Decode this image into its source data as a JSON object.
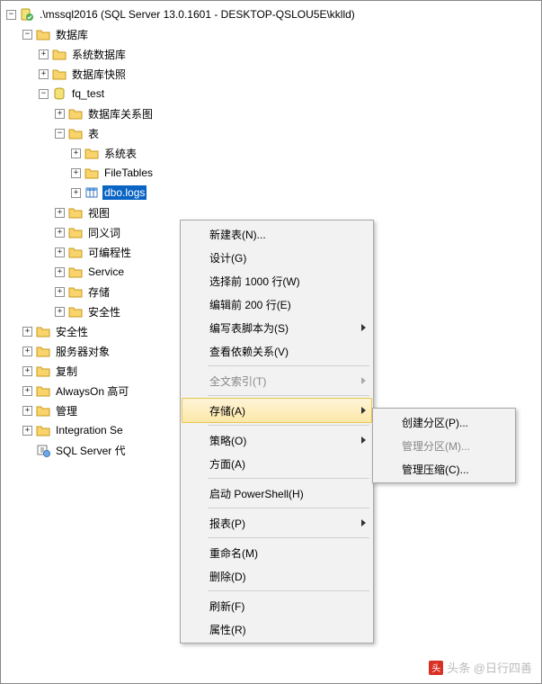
{
  "tree": {
    "root": ".\\mssql2016 (SQL Server 13.0.1601 - DESKTOP-QSLOU5E\\kklld)",
    "databases": "数据库",
    "system_dbs": "系统数据库",
    "db_snapshot": "数据库快照",
    "fq_test": "fq_test",
    "db_diagrams": "数据库关系图",
    "tables": "表",
    "system_tables": "系统表",
    "file_tables": "FileTables",
    "dbo_logs": "dbo.logs",
    "views": "视图",
    "synonyms": "同义词",
    "programmability": "可编程性",
    "service_broker": "Service",
    "storage": "存储",
    "security_db": "安全性",
    "security": "安全性",
    "server_objects": "服务器对象",
    "replication": "复制",
    "always_on": "AlwaysOn 高可",
    "management": "管理",
    "integration_services": "Integration Se",
    "sql_agent": "SQL Server 代"
  },
  "menu": {
    "new_table": "新建表(N)...",
    "design": "设计(G)",
    "select_top": "选择前 1000 行(W)",
    "edit_top": "编辑前 200 行(E)",
    "script_as": "编写表脚本为(S)",
    "view_deps": "查看依赖关系(V)",
    "fulltext": "全文索引(T)",
    "storage": "存储(A)",
    "policies": "策略(O)",
    "facets": "方面(A)",
    "powershell": "启动 PowerShell(H)",
    "reports": "报表(P)",
    "rename": "重命名(M)",
    "delete": "删除(D)",
    "refresh": "刷新(F)",
    "properties": "属性(R)"
  },
  "submenu": {
    "create_partition": "创建分区(P)...",
    "manage_partition": "管理分区(M)...",
    "manage_compression": "管理压缩(C)..."
  },
  "watermark": "头条 @日行四善"
}
